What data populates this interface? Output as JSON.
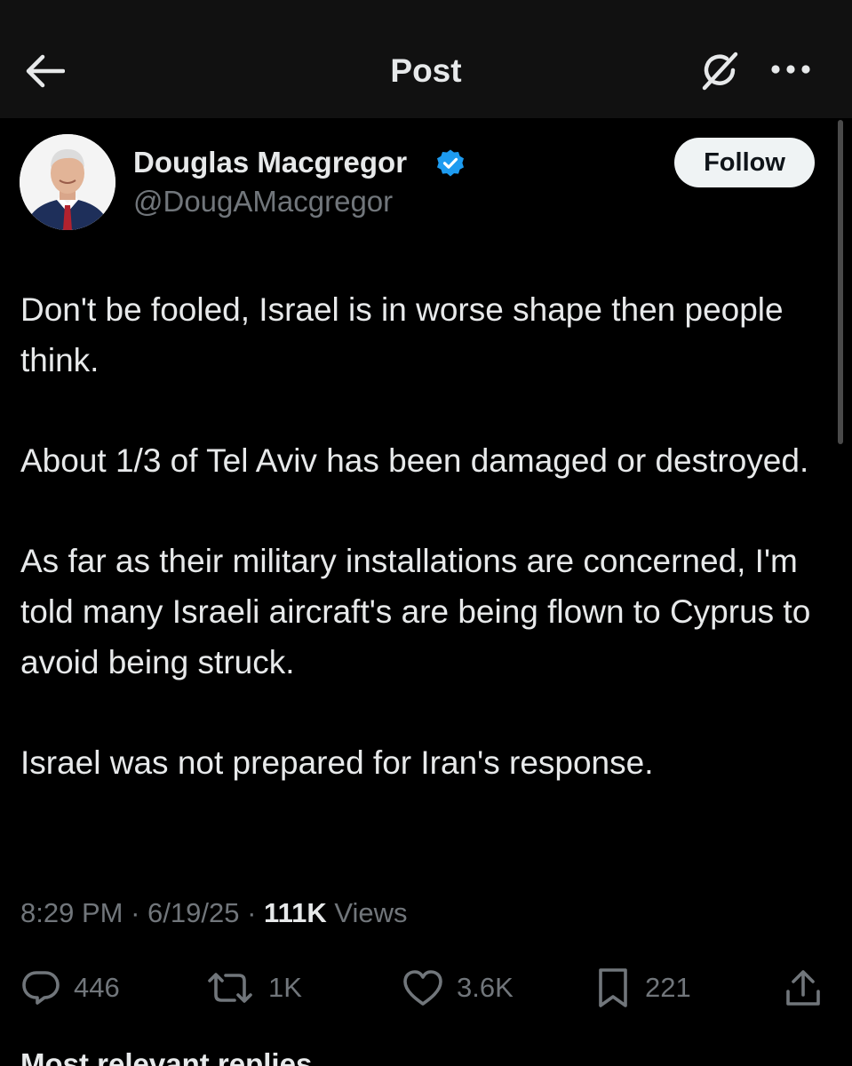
{
  "header": {
    "title": "Post",
    "back_icon": "arrow-left-icon",
    "grok_icon": "grok-icon",
    "more_icon": "more-horizontal-icon"
  },
  "author": {
    "name": "Douglas Macgregor",
    "handle": "@DougAMacgregor",
    "verified": true,
    "verified_color": "#1d9bf0",
    "follow_label": "Follow"
  },
  "post": {
    "paragraphs": [
      "Don't be fooled, Israel is in worse shape then people think.",
      "About 1/3 of Tel Aviv has been damaged or destroyed.",
      "As far as their military installations are concerned, I'm told many Israeli aircraft's are being flown to Cyprus to avoid being struck.",
      "Israel was not prepared for Iran's response."
    ],
    "time": "8:29 PM",
    "date": "6/19/25",
    "separator": "·",
    "views_count": "111K",
    "views_label": "Views"
  },
  "actions": {
    "replies": "446",
    "reposts": "1K",
    "likes": "3.6K",
    "bookmarks": "221"
  },
  "next_section_peek": "Most relevant replies",
  "colors": {
    "background": "#000000",
    "header_background": "#111111",
    "text_primary": "#e7e9ea",
    "text_secondary": "#71767b",
    "follow_button_bg": "#eff3f4"
  }
}
